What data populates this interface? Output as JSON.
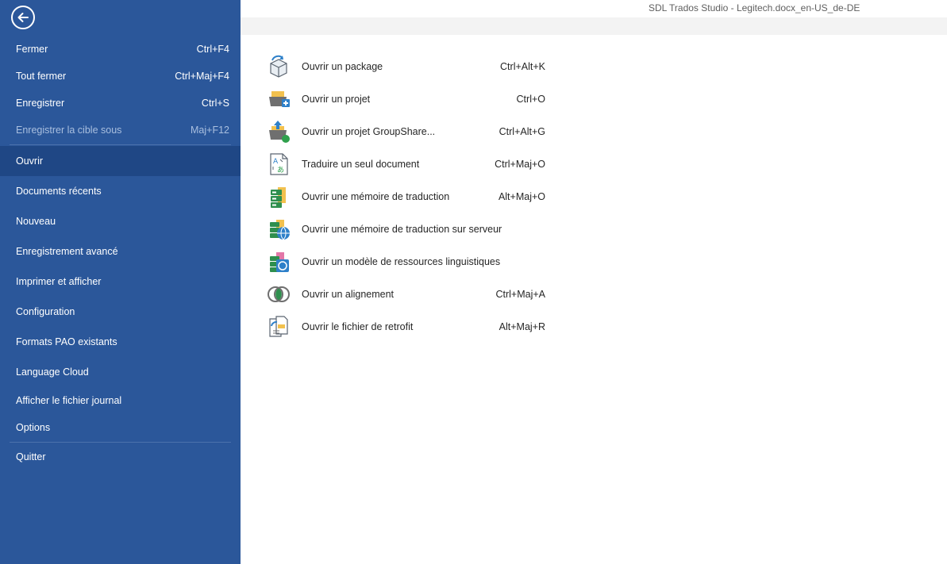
{
  "window": {
    "title": "SDL Trados Studio - Legitech.docx_en-US_de-DE"
  },
  "sidebar": {
    "items": [
      {
        "label": "Fermer",
        "shortcut": "Ctrl+F4"
      },
      {
        "label": "Tout fermer",
        "shortcut": "Ctrl+Maj+F4"
      },
      {
        "label": "Enregistrer",
        "shortcut": "Ctrl+S"
      },
      {
        "label": "Enregistrer la cible sous",
        "shortcut": "Maj+F12"
      },
      {
        "label": "Ouvrir"
      },
      {
        "label": "Documents récents"
      },
      {
        "label": "Nouveau"
      },
      {
        "label": "Enregistrement avancé"
      },
      {
        "label": "Imprimer et afficher"
      },
      {
        "label": "Configuration"
      },
      {
        "label": "Formats PAO existants"
      },
      {
        "label": "Language Cloud"
      },
      {
        "label": "Afficher le fichier journal"
      },
      {
        "label": "Options"
      },
      {
        "label": "Quitter"
      }
    ]
  },
  "open_panel": {
    "items": [
      {
        "label": "Ouvrir un package",
        "shortcut": "Ctrl+Alt+K",
        "icon": "package-icon"
      },
      {
        "label": "Ouvrir un projet",
        "shortcut": "Ctrl+O",
        "icon": "project-folder-icon"
      },
      {
        "label": "Ouvrir un projet GroupShare...",
        "shortcut": "Ctrl+Alt+G",
        "icon": "groupshare-project-icon"
      },
      {
        "label": "Traduire un seul document",
        "shortcut": "Ctrl+Maj+O",
        "icon": "translate-document-icon"
      },
      {
        "label": "Ouvrir une mémoire de traduction",
        "shortcut": "Alt+Maj+O",
        "icon": "translation-memory-icon"
      },
      {
        "label": "Ouvrir une mémoire de traduction sur serveur",
        "shortcut": "",
        "icon": "server-translation-memory-icon"
      },
      {
        "label": "Ouvrir un modèle de ressources linguistiques",
        "shortcut": "",
        "icon": "language-resource-template-icon"
      },
      {
        "label": "Ouvrir un alignement",
        "shortcut": "Ctrl+Maj+A",
        "icon": "alignment-icon"
      },
      {
        "label": "Ouvrir le fichier de retrofit",
        "shortcut": "Alt+Maj+R",
        "icon": "retrofit-file-icon"
      }
    ]
  }
}
